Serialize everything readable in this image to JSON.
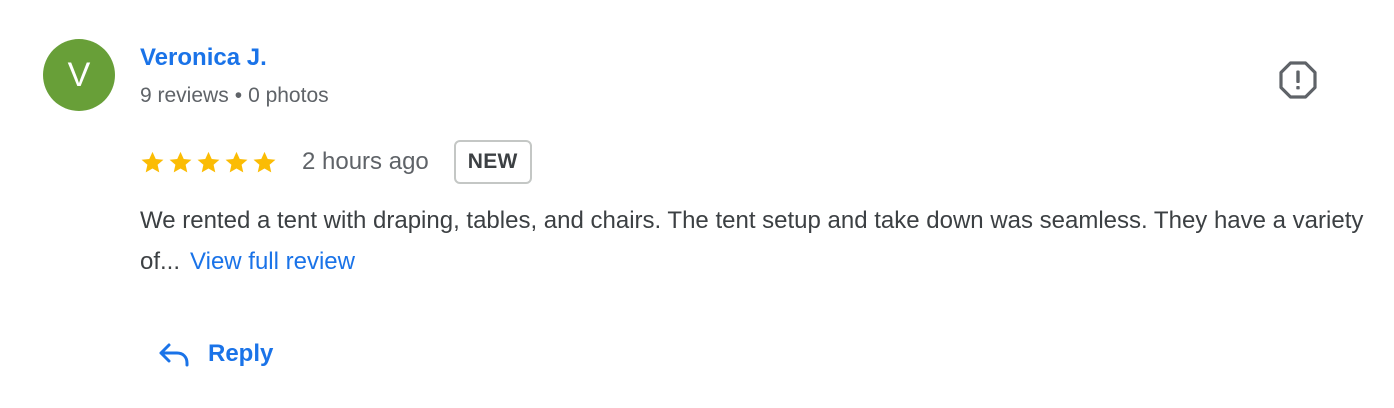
{
  "reviewer": {
    "initial": "V",
    "avatar_color": "#689f38",
    "name": "Veronica J.",
    "reviews": "9 reviews",
    "separator": "•",
    "photos": "0 photos"
  },
  "flag": {
    "icon": "report-flag-icon"
  },
  "rating": {
    "stars": 5,
    "max_stars": 5,
    "star_color": "#fbbc04",
    "time": "2 hours ago",
    "badge": "NEW"
  },
  "review": {
    "text": "We rented a tent with draping, tables, and chairs. The tent setup and take down was seamless. They have a variety of...",
    "view_full": "View full review"
  },
  "actions": {
    "reply_label": "Reply",
    "reply_icon": "reply-arrow-icon"
  },
  "colors": {
    "link": "#1a73e8",
    "text": "#3c4043",
    "secondary": "#5f6368"
  }
}
